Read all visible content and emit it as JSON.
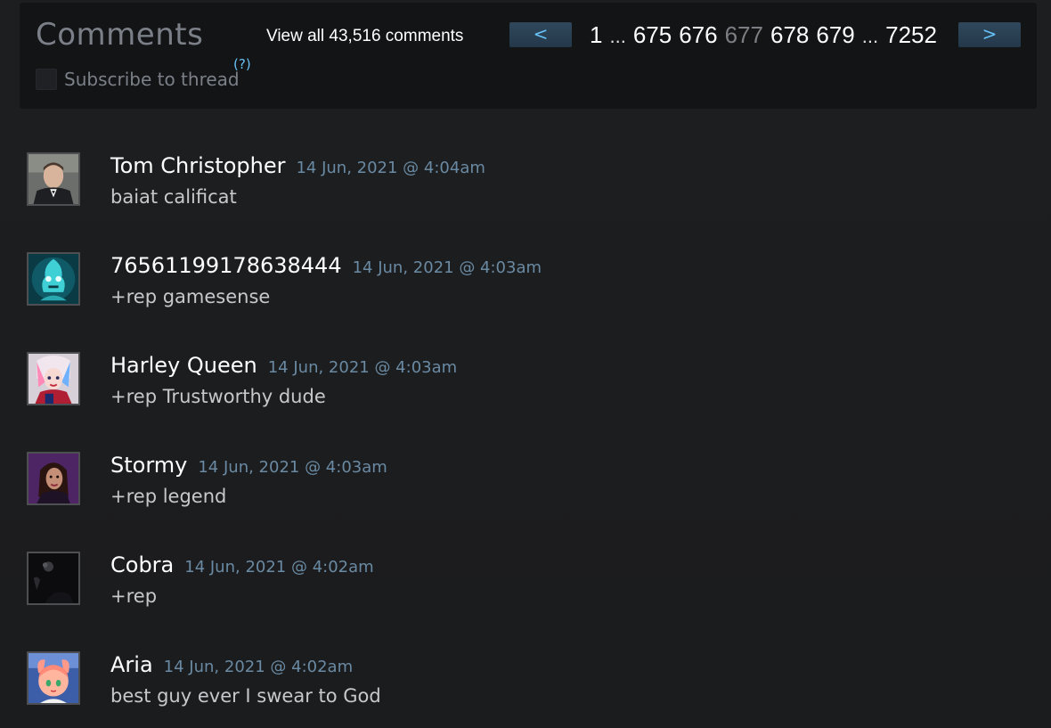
{
  "header": {
    "title": "Comments",
    "view_all": "View all 43,516 comments",
    "prev_label": "<",
    "next_label": ">",
    "pages": [
      {
        "label": "1",
        "current": false
      },
      {
        "label": "...",
        "ellipsis": true
      },
      {
        "label": "675",
        "current": false
      },
      {
        "label": "676",
        "current": false
      },
      {
        "label": "677",
        "current": true
      },
      {
        "label": "678",
        "current": false
      },
      {
        "label": "679",
        "current": false
      },
      {
        "label": "...",
        "ellipsis": true
      },
      {
        "label": "7252",
        "current": false
      }
    ],
    "subscribe_label": "Subscribe to thread",
    "help_label": "(?)"
  },
  "comments": [
    {
      "author": "Tom Christopher",
      "timestamp": "14 Jun, 2021 @ 4:04am",
      "text": "baiat calificat",
      "avatar": "man-in-suit-avatar"
    },
    {
      "author": "76561199178638444",
      "timestamp": "14 Jun, 2021 @ 4:03am",
      "text": "+rep gamesense",
      "avatar": "cyan-robot-avatar"
    },
    {
      "author": "Harley Queen",
      "timestamp": "14 Jun, 2021 @ 4:03am",
      "text": "+rep Trustworthy dude",
      "avatar": "harley-quinn-avatar"
    },
    {
      "author": "Stormy",
      "timestamp": "14 Jun, 2021 @ 4:03am",
      "text": "+rep legend",
      "avatar": "woman-portrait-avatar"
    },
    {
      "author": "Cobra",
      "timestamp": "14 Jun, 2021 @ 4:02am",
      "text": "+rep",
      "avatar": "dark-figure-avatar"
    },
    {
      "author": "Aria",
      "timestamp": "14 Jun, 2021 @ 4:02am",
      "text": "best guy ever I swear to God",
      "avatar": "anime-girl-avatar"
    }
  ],
  "colors": {
    "background": "#1b1c1e",
    "panel": "#131416",
    "accent": "#67c1f5",
    "timestamp": "#6a8aa3",
    "author": "#ffffff"
  }
}
